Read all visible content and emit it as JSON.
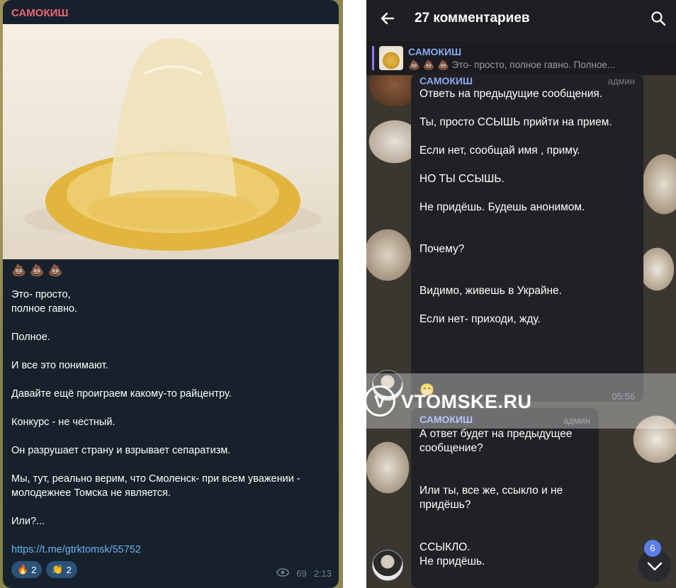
{
  "left_post": {
    "sender": "САМОКИШ",
    "emojis": "💩 💩 💩",
    "paragraphs": [
      "Это- просто,",
      "полное гавно.",
      "Полное.",
      "И все это понимают.",
      "Давайте ещё проиграем какому-то райцентру.",
      "Конкурс - не честный.",
      "Он разрушает страну и взрывает сепаратизм.",
      "Мы, тут, реально верим, что Смоленск- при всем уважении - молодежнее Томска не является.",
      "Или?..."
    ],
    "link": "https://t.me/gtrktomsk/55752",
    "reactions": [
      {
        "emoji": "🔥",
        "count": "2"
      },
      {
        "emoji": "👏",
        "count": "2"
      }
    ],
    "views": "69",
    "time": "2:13"
  },
  "comments_view": {
    "title": "27 комментариев",
    "pinned": {
      "name": "САМОКИШ",
      "preview": "💩 💩 💩  Это- просто,  полное гавно.  Полное..."
    },
    "messages": [
      {
        "name": "САМОКИШ",
        "role": "админ",
        "lines": [
          "Ответь на предыдущие сообщения.",
          "Ты, просто ССЫШЬ прийти на прием.",
          "Если нет, сообщай имя , приму.",
          "НО ТЫ ССЫШЬ.",
          "Не придёшь. Будешь анонимом.",
          "Почему?",
          "Видимо, живешь в Украйне.",
          "Если нет- приходи, жду."
        ],
        "emoji": "😁",
        "time": "05:56"
      },
      {
        "name": "САМОКИШ",
        "role": "админ",
        "lines": [
          "А ответ будет на предыдущее сообщение?",
          "Или ты, все же, ссыкло и не придёшь?",
          "ССЫКЛО.",
          "Не придёшь."
        ]
      }
    ],
    "unread_badge": "6"
  },
  "watermark": {
    "logo": "V",
    "text": "VTOMSKE.RU"
  },
  "colors": {
    "left_bg": "#17212b",
    "sender_red": "#e8677a",
    "link_blue": "#6ab3f3",
    "comment_name": "#8aa8f0",
    "dark_bubble": "#212125"
  }
}
